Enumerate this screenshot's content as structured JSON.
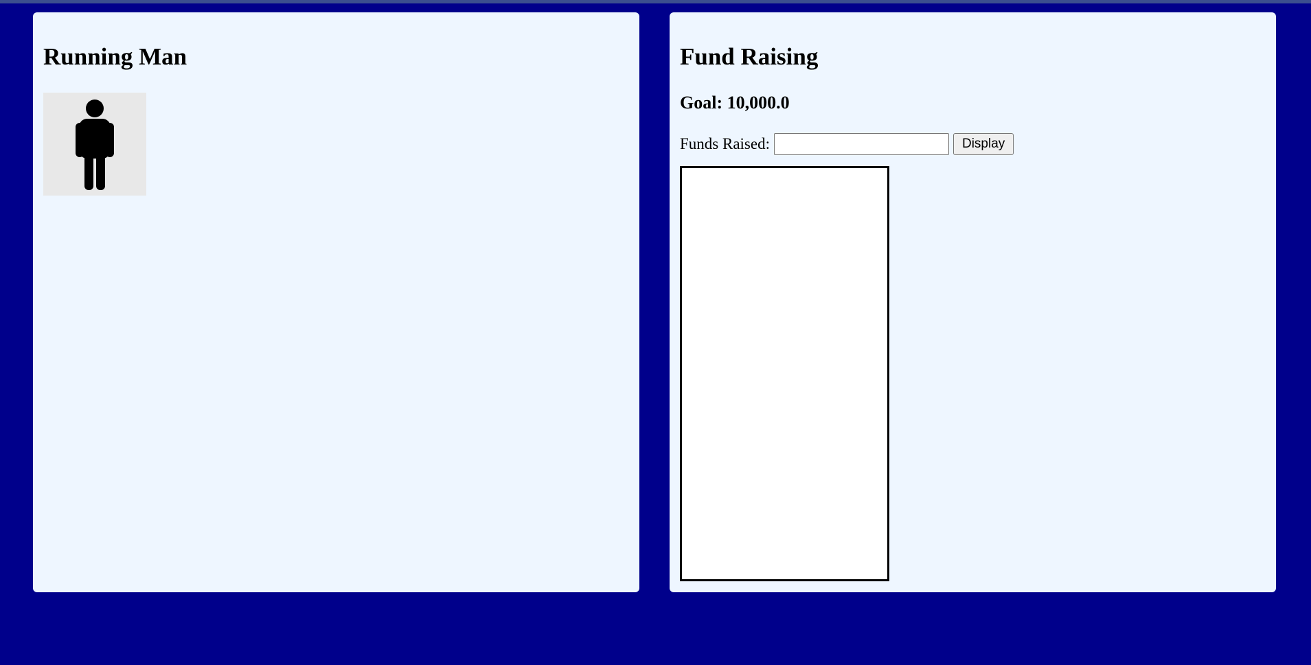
{
  "page": {
    "background_color": "#00008b",
    "panel_color": "#eef6ff"
  },
  "left_panel": {
    "title": "Running Man",
    "figure_icon": "standing-person-icon"
  },
  "right_panel": {
    "title": "Fund Raising",
    "goal_text": "Goal: 10,000.0",
    "funds_label": "Funds Raised:",
    "funds_input_value": "",
    "funds_input_placeholder": "",
    "display_button_label": "Display",
    "progress_fraction": 0
  }
}
